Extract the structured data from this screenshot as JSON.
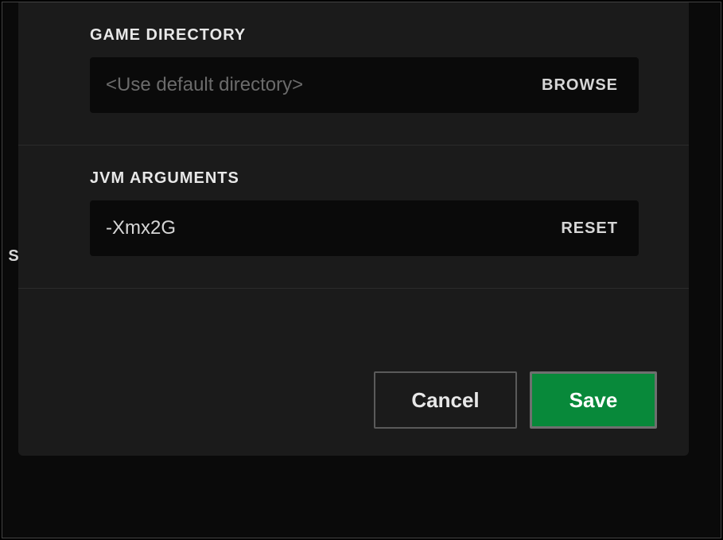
{
  "gameDirectory": {
    "label": "GAME DIRECTORY",
    "placeholder": "<Use default directory>",
    "value": "",
    "browseLabel": "BROWSE"
  },
  "jvmArguments": {
    "label": "JVM ARGUMENTS",
    "value": "-Xmx2G",
    "resetLabel": "RESET"
  },
  "cutoffLeftLabel": "SE",
  "buttons": {
    "cancel": "Cancel",
    "save": "Save"
  }
}
